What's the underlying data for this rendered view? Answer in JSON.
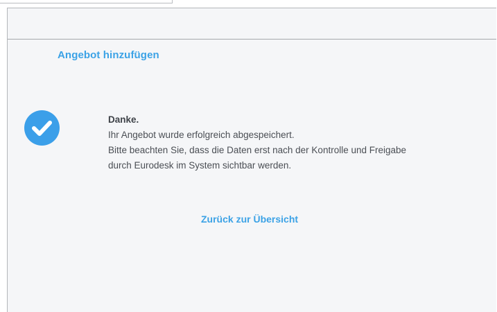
{
  "panel": {
    "title": "Angebot hinzufügen"
  },
  "confirmation": {
    "icon": "check-circle-icon",
    "icon_color": "#3b9fe9",
    "heading": "Danke.",
    "line1": "Ihr Angebot wurde erfolgreich abgespeichert.",
    "line2": "Bitte beachten Sie, dass die Daten erst nach der Kontrolle und Freigabe",
    "line3": "durch Eurodesk im System sichtbar werden."
  },
  "actions": {
    "back_label": "Zurück zur Übersicht"
  },
  "colors": {
    "accent": "#3ba2e6",
    "panel_background": "#f5f6f8",
    "text": "#4a4e54"
  }
}
